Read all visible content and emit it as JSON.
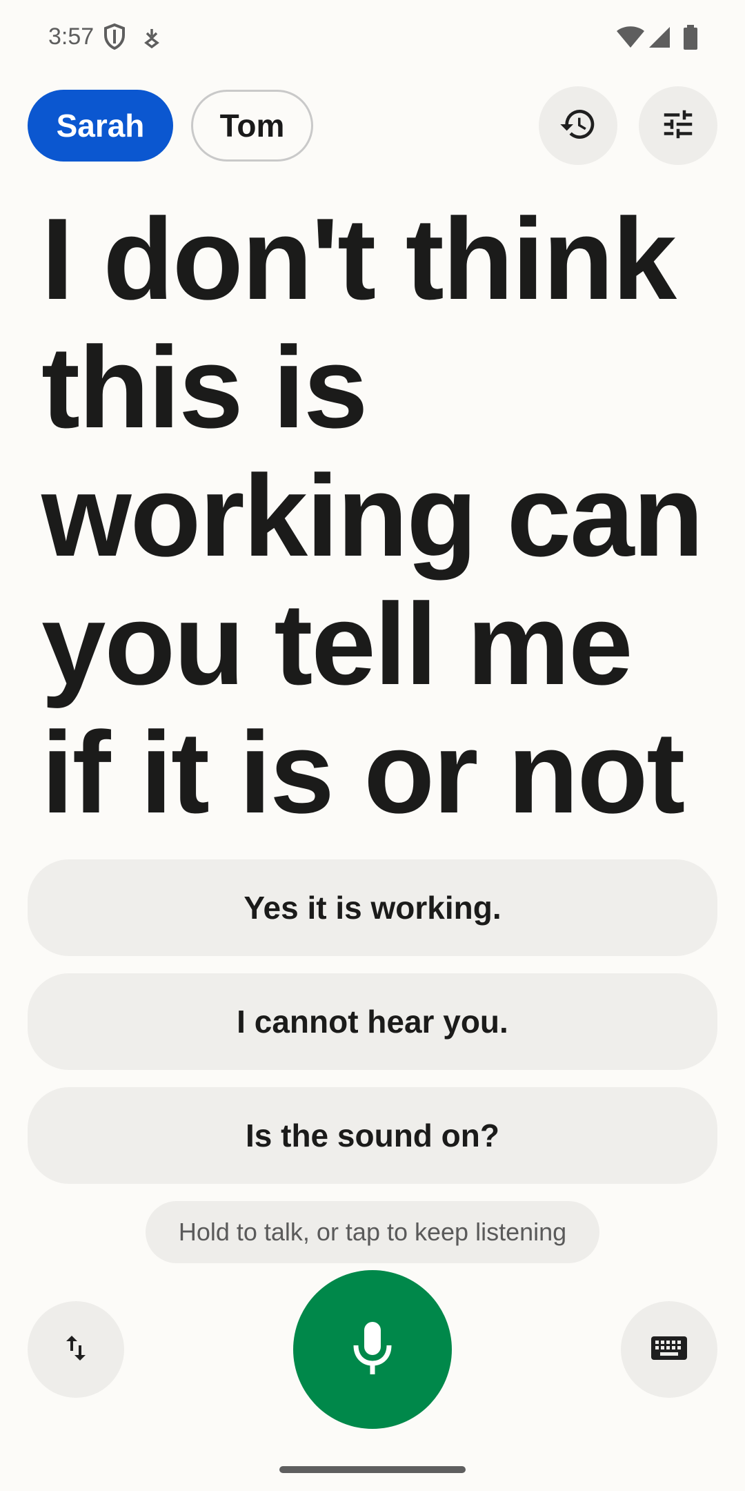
{
  "status_bar": {
    "time": "3:57",
    "icons": [
      "shield-icon",
      "download-indicator-icon",
      "wifi-icon",
      "cell-signal-icon",
      "battery-icon"
    ]
  },
  "speakers": [
    {
      "label": "Sarah",
      "selected": true,
      "color": "#0B57D0"
    },
    {
      "label": "Tom",
      "selected": false
    }
  ],
  "toolbar": {
    "icons": [
      "history-icon",
      "tune-icon"
    ]
  },
  "transcript": {
    "text": "I don't think this is working can you tell me if it is or not"
  },
  "suggestions": [
    {
      "label": "Yes it is working."
    },
    {
      "label": "I cannot hear you."
    },
    {
      "label": "Is the sound on?"
    }
  ],
  "hint": {
    "text": "Hold to talk, or tap to keep listening"
  },
  "bottom_bar": {
    "icons": [
      "swap-vertical-icon",
      "mic-icon",
      "keyboard-icon"
    ],
    "mic_color": "#00884A"
  }
}
